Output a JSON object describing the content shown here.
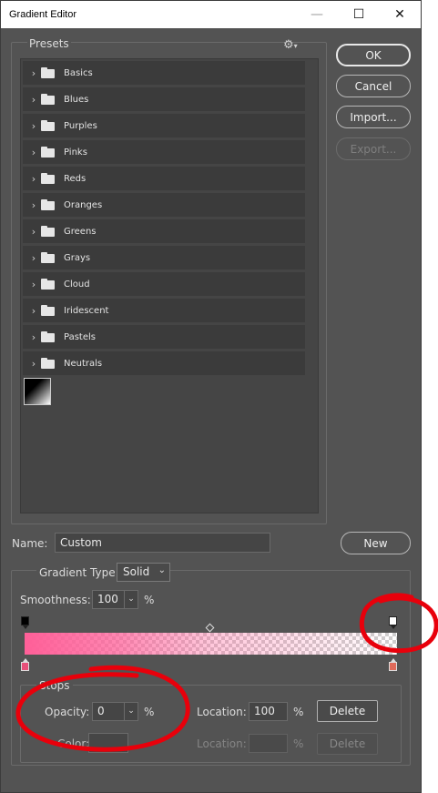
{
  "window": {
    "title": "Gradient Editor"
  },
  "presets": {
    "label": "Presets",
    "folders": [
      "Basics",
      "Blues",
      "Purples",
      "Pinks",
      "Reds",
      "Oranges",
      "Greens",
      "Grays",
      "Cloud",
      "Iridescent",
      "Pastels",
      "Neutrals"
    ]
  },
  "buttons": {
    "ok": "OK",
    "cancel": "Cancel",
    "import": "Import...",
    "export": "Export...",
    "new": "New"
  },
  "name": {
    "label": "Name:",
    "value": "Custom"
  },
  "gradient": {
    "type_label": "Gradient Type:",
    "type_value": "Solid",
    "smoothness_label": "Smoothness:",
    "smoothness_value": "100",
    "percent": "%",
    "colors": {
      "start": "#ff5f98",
      "start_stop": "#e8507a",
      "end_stop": "#e06a5a"
    }
  },
  "stops": {
    "label": "Stops",
    "opacity_label": "Opacity:",
    "opacity_value": "0",
    "location_label": "Location:",
    "location_value": "100",
    "delete_label": "Delete",
    "color_label": "Color:",
    "location2_label": "Location:",
    "delete2_label": "Delete"
  }
}
